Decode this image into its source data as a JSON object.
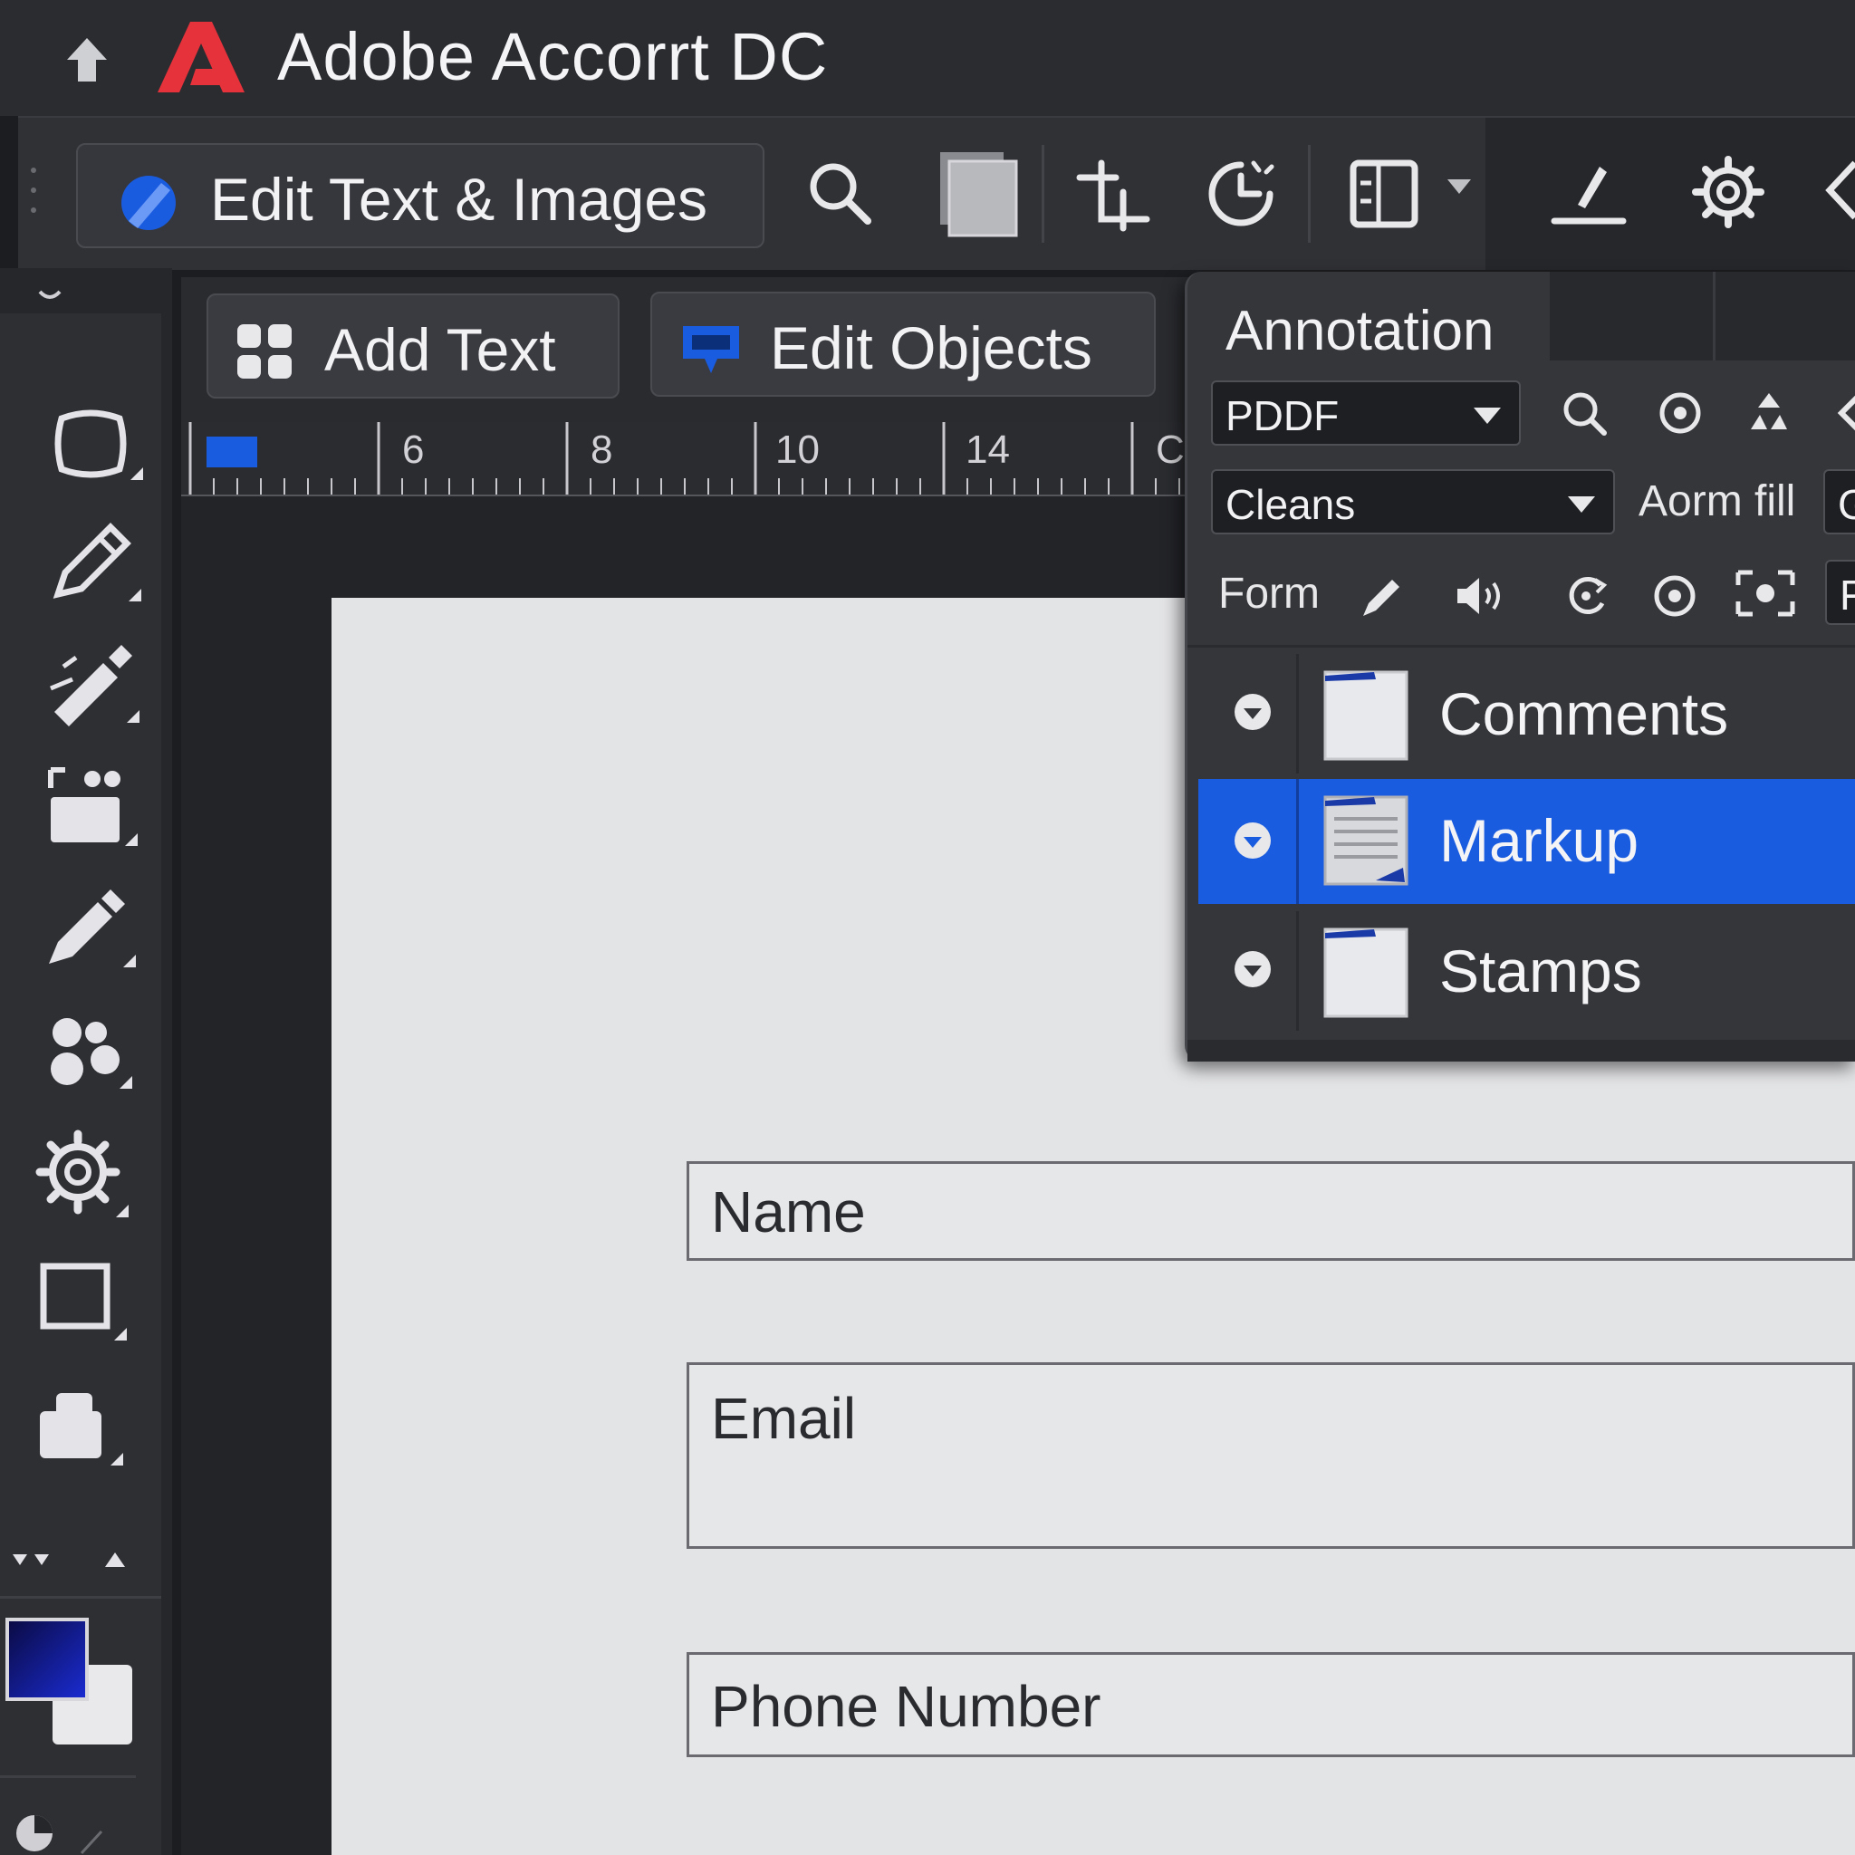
{
  "app": {
    "title": "Adobe Accorrt DC"
  },
  "toolbar": {
    "edit_label": "Edit Text & Images",
    "icons": [
      "search-icon",
      "pages-icon",
      "crop-icon",
      "timer-icon",
      "panel-icon",
      "sign-icon",
      "settings-icon",
      "share-icon"
    ]
  },
  "subbar": {
    "add_text": "Add Text",
    "edit_objects": "Edit Objects"
  },
  "ruler": {
    "ticks": [
      "6",
      "8",
      "10",
      "14",
      "C"
    ]
  },
  "form": {
    "name_label": "Name",
    "email_label": "Email",
    "phone_label": "Phone Number"
  },
  "panel": {
    "title": "Annotation",
    "dropdown1": "PDDF",
    "dropdown2": "Cleans",
    "aorm_fill": "Aorm fill",
    "form_label": "Form",
    "trailing1": "G",
    "trailing2": "F",
    "rows": [
      {
        "label": "Comments",
        "selected": false
      },
      {
        "label": "Markup",
        "selected": true
      },
      {
        "label": "Stamps",
        "selected": false
      }
    ]
  },
  "colors": {
    "accent": "#1a5ce0",
    "logo_red": "#e5323b",
    "fg_swatch": "#1a2bd0"
  }
}
